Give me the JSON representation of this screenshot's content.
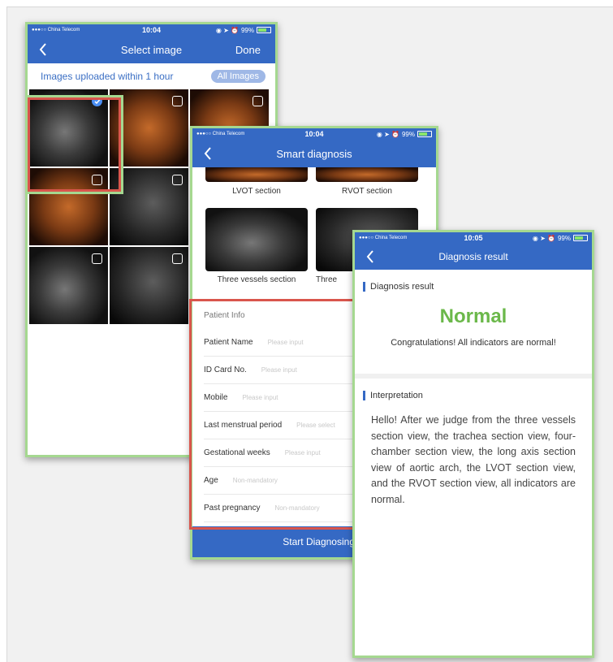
{
  "status": {
    "carrier": "●●●○○ China Telecom",
    "battery": "99%",
    "icons": "◉ ➤ ⏰"
  },
  "select_screen": {
    "time": "10:04",
    "title": "Select image",
    "done": "Done",
    "filter_label": "Images uploaded within 1 hour",
    "all_images": "All Images"
  },
  "diagnosis_screen": {
    "time": "10:04",
    "title": "Smart diagnosis",
    "sections": [
      "LVOT section",
      "RVOT section",
      "Three vessels section",
      "Three"
    ],
    "patient_info": "Patient Info",
    "fields": [
      {
        "label": "Patient Name",
        "placeholder": "Please input"
      },
      {
        "label": "ID Card No.",
        "placeholder": "Please input"
      },
      {
        "label": "Mobile",
        "placeholder": "Please input"
      },
      {
        "label": "Last menstrual period",
        "placeholder": "Please select"
      },
      {
        "label": "Gestational weeks",
        "placeholder": "Please input"
      },
      {
        "label": "Age",
        "placeholder": "Non-mandatory"
      },
      {
        "label": "Past pregnancy",
        "placeholder": "Non-mandatory"
      }
    ],
    "start_button": "Start Diagnosing"
  },
  "result_screen": {
    "time": "10:05",
    "title": "Diagnosis result",
    "result_heading": "Diagnosis result",
    "result_value": "Normal",
    "congrats": "Congratulations! All indicators are normal!",
    "interpretation_heading": "Interpretation",
    "interpretation": "Hello! After we judge from the three vessels section view, the trachea section view, four-chamber section view, the long axis section view of aortic arch, the LVOT section view, and the RVOT section view, all indicators are normal."
  },
  "colors": {
    "primary": "#3569c4",
    "normal_green": "#6bb84a",
    "frame_green": "#a5d890",
    "highlight_red": "#d9554c"
  }
}
